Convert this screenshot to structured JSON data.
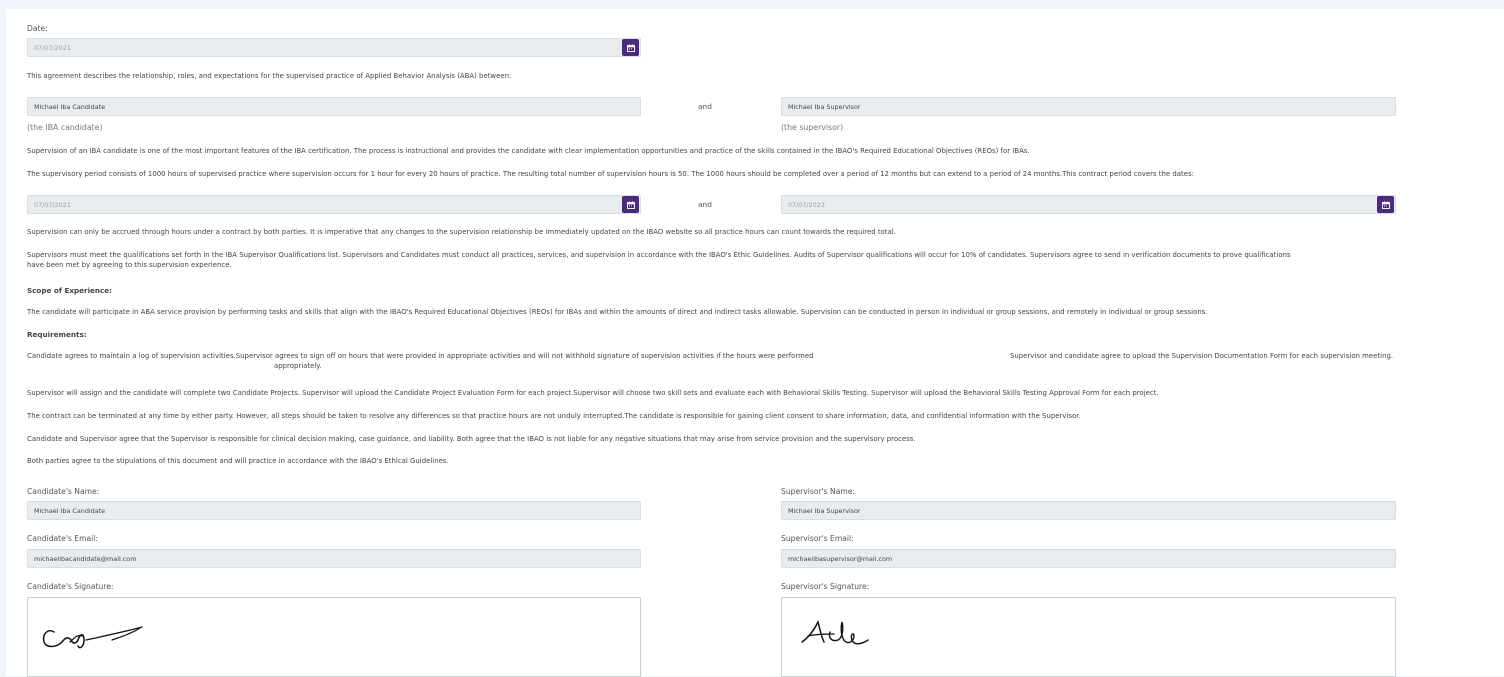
{
  "date_section": {
    "label": "Date:",
    "value": "07/07/2021"
  },
  "intro_text": "This agreement describes the relationship, roles, and expectations for the supervised practice of Applied Behavior Analysis (ABA) between:",
  "parties": {
    "candidate_value": "Michael Iba Candidate",
    "candidate_sublabel": "(the IBA candidate)",
    "and_label": "and",
    "supervisor_value": "Michael Iba Supervisor",
    "supervisor_sublabel": "(the supervisor)"
  },
  "supervision_text": "Supervision of an IBA candidate is one of the most important features of the IBA certification. The process is instructional and provides the candidate with clear implementation opportunities and practice of the skills contained in the IBAO's Required Educational Objectives (REOs) for IBAs.",
  "period_text": "The supervisory period consists of 1000 hours of supervised practice where supervision occurs for 1 hour for every 20 hours of practice. The resulting total number of supervision hours is 50. The 1000 hours should be completed over a period of 12 months but can extend to a period of 24 months.This contract period covers the dates:",
  "contract_period": {
    "start_date": "07/07/2021",
    "and_label": "and",
    "end_date": "07/07/2023"
  },
  "accrual_text": "Supervision can only be accrued through hours under a contract by both parties. It is imperative that any changes to the supervision relationship be immediately updated on the IBAO website so all practice hours can count towards the required total.",
  "qualifications_text_line1": "Supervisors must meet the qualifications set forth in the IBA Supervisor Qualifications list. Supervisors and Candidates must conduct all practices, services, and supervision in accordance with the IBAO's Ethic Guidelines. Audits of Supervisor qualifications will occur for 10% of candidates. Supervisors agree to send in verification documents to prove qualifications",
  "qualifications_text_line2": "have been met by agreeing to this supervision experience.",
  "scope_heading": "Scope of Experience:",
  "scope_text": "The candidate will participate in ABA service provision by performing tasks and skills that align with the IBAO's Required Educational Objectives (REOs) for IBAs and within the amounts of direct and indirect tasks allowable. Supervision can be conducted in person in individual or group sessions, and remotely in individual or group sessions.",
  "requirements_heading": "Requirements:",
  "requirements": {
    "log_text_part1": "Candidate agrees to maintain a log of supervision activities.Supervisor agrees to sign off on hours that were provided in appropriate activities and will not withhold signature of supervision activities if the hours were performed",
    "log_text_part2": "Supervisor and candidate agree to upload the Supervision Documentation Form for each supervision meeting.",
    "log_text_part3": "appropriately.",
    "projects_text": "Supervisor will assign and the candidate will complete two Candidate Projects. Supervisor will upload the Candidate Project Evaluation Form for each project.Supervisor will choose two skill sets and evaluate each with Behavioral Skills Testing. Supervisor will upload the Behavioral Skills Testing Approval Form for each project.",
    "termination_text": "The contract can be terminated at any time by either party. However, all steps should be taken to resolve any differences so that practice hours are not unduly interrupted.The candidate is responsible for gaining client consent to share information, data, and confidential information with the Supervisor.",
    "liability_text": "Candidate and Supervisor agree that the Supervisor is responsible for clinical decision making, case guidance, and liability. Both agree that the IBAO is not liable for any negative situations that may arise from service provision and the supervisory process.",
    "stipulations_text": "Both parties agree to the stipulations of this document and will practice in accordance with the IBAO's Ethical Guidelines."
  },
  "candidate": {
    "name_label": "Candidate's Name:",
    "name_value": "Michael Iba Candidate",
    "email_label": "Candidate's Email:",
    "email_value": "michaelibacandidate@mail.com",
    "signature_label": "Candidate's Signature:"
  },
  "supervisor": {
    "name_label": "Supervisor's Name:",
    "name_value": "Michael Iba Supervisor",
    "email_label": "Supervisor's Email:",
    "email_value": "michaelibasupervisor@mail.com",
    "signature_label": "Supervisor's Signature:"
  },
  "icons": {
    "date_picker": "calendar-icon"
  },
  "colors": {
    "accent": "#4c2a7c",
    "field_bg": "#e9ecef",
    "page_bg": "#f0f5fb"
  }
}
